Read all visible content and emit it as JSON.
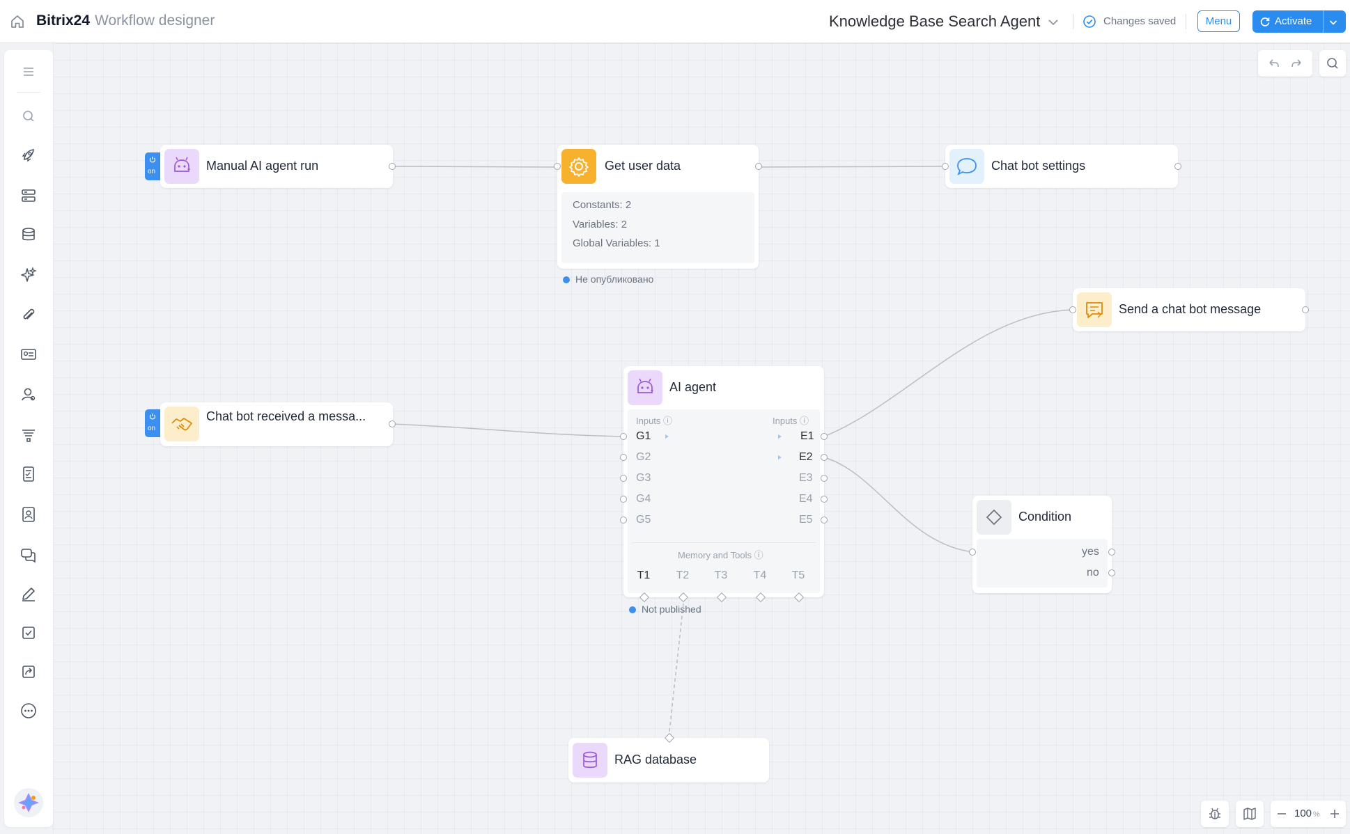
{
  "header": {
    "brand": "Bitrix24",
    "brand_sub": "Workflow designer",
    "workflow_title": "Knowledge Base Search Agent",
    "saved_status": "Changes saved",
    "menu_label": "Menu",
    "activate_label": "Activate"
  },
  "sidebar": {
    "items": [
      {
        "icon": "menu-icon"
      },
      {
        "icon": "search-icon"
      },
      {
        "icon": "rocket-icon"
      },
      {
        "icon": "forms-icon"
      },
      {
        "icon": "database-icon"
      },
      {
        "icon": "sparkles-icon"
      },
      {
        "icon": "paperclip-icon"
      },
      {
        "icon": "id-card-icon"
      },
      {
        "icon": "user-icon"
      },
      {
        "icon": "funnel-icon"
      },
      {
        "icon": "calculator-icon"
      },
      {
        "icon": "contact-icon"
      },
      {
        "icon": "chat-icon"
      },
      {
        "icon": "pen-icon"
      },
      {
        "icon": "checkbox-icon"
      },
      {
        "icon": "share-icon"
      },
      {
        "icon": "more-icon"
      }
    ],
    "avatar_icon": "ai-assistant-icon"
  },
  "nodes": {
    "manual_run": {
      "title": "Manual AI agent run",
      "tab": "on"
    },
    "get_user_data": {
      "title": "Get user data",
      "lines": [
        "Constants: 2",
        "Variables: 2",
        "Global Variables: 1"
      ],
      "status": "Не опубликовано"
    },
    "chat_bot_settings": {
      "title": "Chat bot settings"
    },
    "send_message": {
      "title": "Send a chat bot message"
    },
    "chat_received": {
      "title": "Chat bot received a messa...",
      "tab": "on"
    },
    "ai_agent": {
      "title": "AI agent",
      "inputs_left": "Inputs",
      "inputs_right": "Inputs",
      "left_ports": [
        "G1",
        "G2",
        "G3",
        "G4",
        "G5"
      ],
      "right_ports": [
        "E1",
        "E2",
        "E3",
        "E4",
        "E5"
      ],
      "memory_tools": "Memory and Tools",
      "tools": [
        "T1",
        "T2",
        "T3",
        "T4",
        "T5"
      ],
      "status": "Not published"
    },
    "condition": {
      "title": "Condition",
      "yes": "yes",
      "no": "no"
    },
    "rag": {
      "title": "RAG database"
    }
  },
  "zoom": {
    "value": "100",
    "unit": "%"
  },
  "colors": {
    "accent": "#2b8cf0",
    "ai_purple": "#ead9fb",
    "gear_orange": "#f7b12e",
    "chat_blue": "#e3f1fd",
    "message_yellow": "#fdeecb"
  }
}
